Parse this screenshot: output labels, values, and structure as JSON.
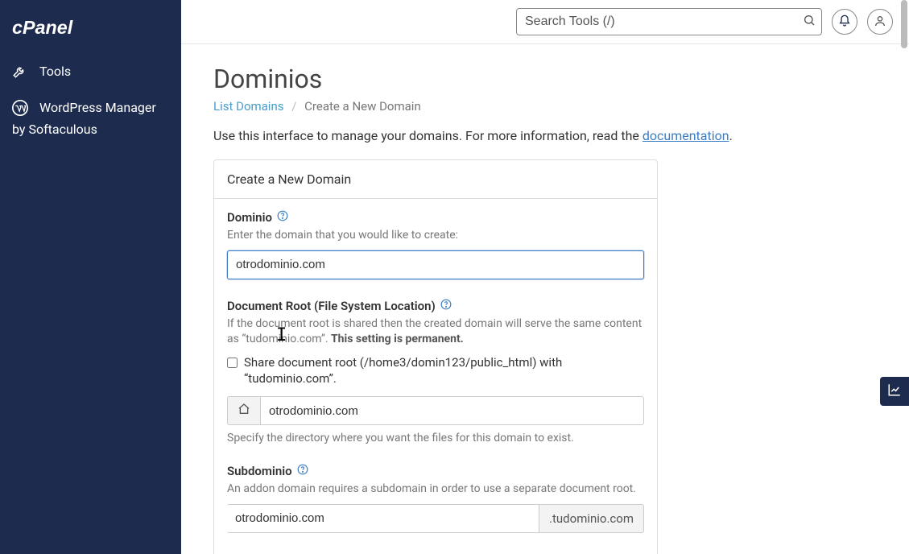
{
  "brand": "cPanel",
  "sidebar": {
    "items": [
      {
        "label": "Tools",
        "icon": "tools-icon"
      },
      {
        "label": "WordPress Manager",
        "label2": "by Softaculous",
        "icon": "wordpress-icon"
      }
    ]
  },
  "topbar": {
    "search_placeholder": "Search Tools (/)"
  },
  "page": {
    "title": "Dominios",
    "breadcrumb": {
      "link_label": "List Domains",
      "current": "Create a New Domain"
    },
    "intro_prefix": "Use this interface to manage your domains. For more information, read the ",
    "intro_link": "documentation",
    "intro_suffix": "."
  },
  "panel": {
    "header": "Create a New Domain",
    "domain": {
      "label": "Dominio",
      "hint": "Enter the domain that you would like to create:",
      "value": "otrodominio.com"
    },
    "docroot": {
      "label": "Document Root (File System Location)",
      "hint_prefix": "If the document root is shared then the created domain will serve the same content as “tudominio.com”. ",
      "hint_strong": "This setting is permanent.",
      "checkbox_label": "Share document root (/home3/domin123/public_html) with “tudominio.com”.",
      "value": "otrodominio.com",
      "below_hint": "Specify the directory where you want the files for this domain to exist."
    },
    "subdomain": {
      "label": "Subdominio",
      "hint": "An addon domain requires a subdomain in order to use a separate document root.",
      "value": "otrodominio.com",
      "suffix": ".tudominio.com"
    }
  }
}
